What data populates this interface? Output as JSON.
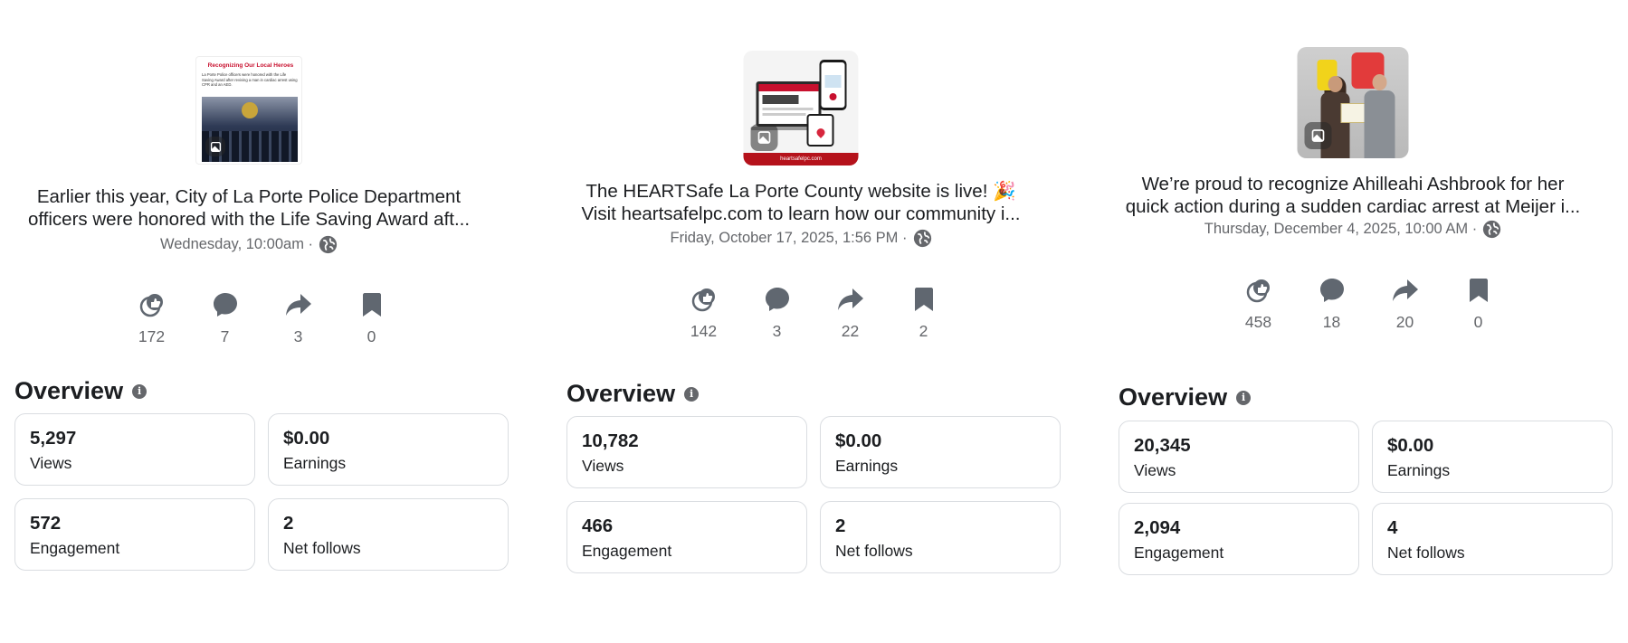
{
  "colors": {
    "icon": "#606770",
    "text": "#1c1e21",
    "muted": "#65676b",
    "border": "#dadde1"
  },
  "posts": [
    {
      "thumb_kind": "poster",
      "thumb_title": "Recognizing Our Local Heroes",
      "thumb_body": "La Porte Police officers were honored with the Life Saving Award after reviving a man in cardiac arrest using CPR and an AED.",
      "caption_line1": "Earlier this year, City of La Porte Police Department",
      "caption_line2": "officers were honored with the Life Saving Award aft...",
      "date": "Wednesday, 10:00am ·",
      "stats": [
        {
          "icon": "reactions-icon",
          "value": "172"
        },
        {
          "icon": "comment-icon",
          "value": "7"
        },
        {
          "icon": "share-icon",
          "value": "3"
        },
        {
          "icon": "bookmark-icon",
          "value": "0"
        }
      ],
      "overview_title": "Overview",
      "cards": [
        {
          "value": "5,297",
          "label": "Views"
        },
        {
          "value": "$0.00",
          "label": "Earnings"
        },
        {
          "value": "572",
          "label": "Engagement"
        },
        {
          "value": "2",
          "label": "Net follows"
        }
      ]
    },
    {
      "thumb_kind": "devices",
      "thumb_footer": "heartsafelpc.com",
      "caption_line1": "The HEARTSafe La Porte County website is live! 🎉",
      "caption_line2": "Visit heartsafelpc.com to learn how our community i...",
      "date": "Friday, October 17, 2025, 1:56 PM ·",
      "stats": [
        {
          "icon": "reactions-icon",
          "value": "142"
        },
        {
          "icon": "comment-icon",
          "value": "3"
        },
        {
          "icon": "share-icon",
          "value": "22"
        },
        {
          "icon": "bookmark-icon",
          "value": "2"
        }
      ],
      "overview_title": "Overview",
      "cards": [
        {
          "value": "10,782",
          "label": "Views"
        },
        {
          "value": "$0.00",
          "label": "Earnings"
        },
        {
          "value": "466",
          "label": "Engagement"
        },
        {
          "value": "2",
          "label": "Net follows"
        }
      ]
    },
    {
      "thumb_kind": "photo",
      "caption_line1": "We’re proud to recognize Ahilleahi Ashbrook for her",
      "caption_line2": "quick action during a sudden cardiac arrest at Meijer i...",
      "date": "Thursday, December 4, 2025, 10:00 AM ·",
      "stats": [
        {
          "icon": "reactions-icon",
          "value": "458"
        },
        {
          "icon": "comment-icon",
          "value": "18"
        },
        {
          "icon": "share-icon",
          "value": "20"
        },
        {
          "icon": "bookmark-icon",
          "value": "0"
        }
      ],
      "overview_title": "Overview",
      "cards": [
        {
          "value": "20,345",
          "label": "Views"
        },
        {
          "value": "$0.00",
          "label": "Earnings"
        },
        {
          "value": "2,094",
          "label": "Engagement"
        },
        {
          "value": "4",
          "label": "Net follows"
        }
      ]
    }
  ]
}
